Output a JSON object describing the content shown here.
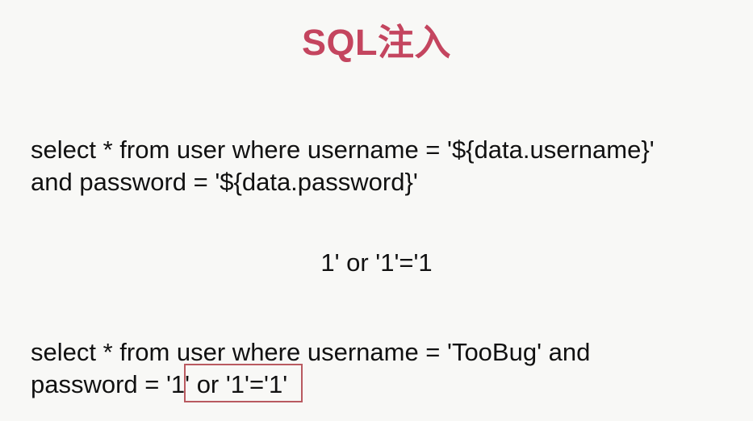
{
  "title": "SQL注入",
  "query_template": {
    "line_1": "select * from user where username = '${data.username}'",
    "line_2": "and password = '${data.password}'"
  },
  "payload": "1' or '1'='1",
  "injected_query": {
    "line_1": "select * from user where username = 'TooBug' and",
    "line_2_prefix": "password = '",
    "line_2_injected": "1' or '1'='1",
    "line_2_suffix": "'"
  },
  "colors": {
    "title": "#c4455f",
    "text": "#111111",
    "background": "#f8f8f6",
    "highlight_border": "#b95a60"
  }
}
